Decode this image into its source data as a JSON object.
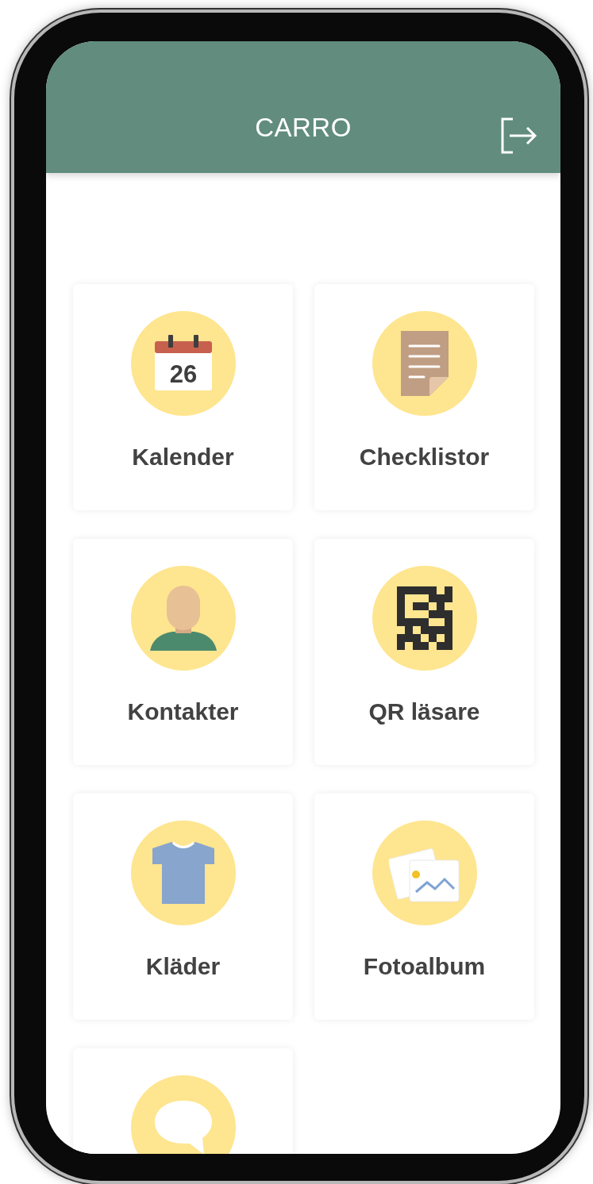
{
  "header": {
    "title": "CARRO"
  },
  "tiles": [
    {
      "kind": "calendar",
      "label": "Kalender",
      "date": "26"
    },
    {
      "kind": "document",
      "label": "Checklistor"
    },
    {
      "kind": "person",
      "label": "Kontakter"
    },
    {
      "kind": "qr",
      "label": "QR läsare"
    },
    {
      "kind": "shirt",
      "label": "Kläder"
    },
    {
      "kind": "photos",
      "label": "Fotoalbum"
    },
    {
      "kind": "chat"
    }
  ]
}
